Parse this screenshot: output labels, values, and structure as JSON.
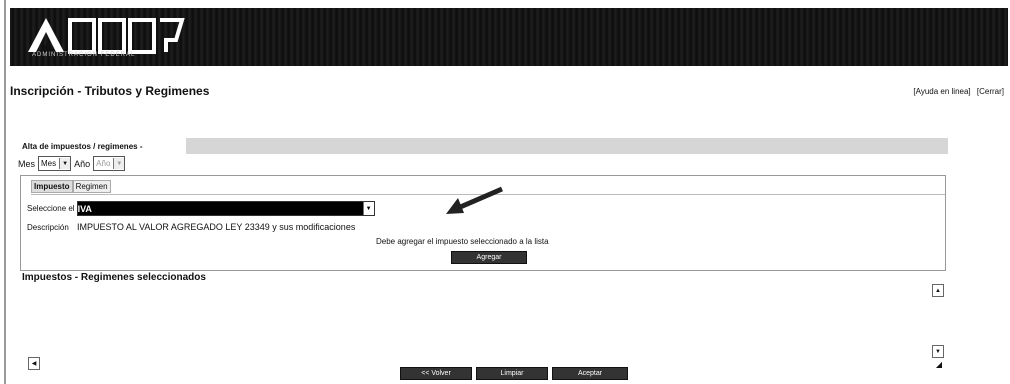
{
  "header": {
    "logo_text": "AFIP",
    "logo_subtitle": "ADMINISTRACION FEDERAL"
  },
  "page": {
    "title": "Inscripción - Tributos y Regimenes",
    "links": [
      "[Ayuda en linea]",
      "[Cerrar]"
    ]
  },
  "alta": {
    "section_title": "Alta de impuestos / regimenes -",
    "mes_label": "Mes",
    "mes_value": "Mes",
    "anio_label": "Año",
    "anio_value": "Año"
  },
  "tabs": [
    "Impuesto",
    "Regimen"
  ],
  "form": {
    "select_label": "Seleccione el",
    "select_value": "IVA",
    "desc_label": "Descripción",
    "desc_value": "IMPUESTO AL VALOR AGREGADO LEY 23349 y sus modificaciones",
    "message": "Debe agregar el impuesto seleccionado a la lista",
    "agregar_label": "Agregar"
  },
  "list": {
    "title": "Impuestos - Regimenes seleccionados"
  },
  "footer": {
    "volver": "<< Volver",
    "limpiar": "Limpiar",
    "aceptar": "Aceptar"
  },
  "icons": {
    "dropdown": "chevron-down-icon",
    "scroll_up": "scroll-up-arrow-icon",
    "scroll_down": "scroll-down-arrow-icon",
    "scroll_left": "scroll-left-arrow-icon",
    "pointer": "annotation-arrow-icon"
  },
  "colors": {
    "banner": "#111111",
    "button": "#333333",
    "highlight_select": "#000000"
  }
}
